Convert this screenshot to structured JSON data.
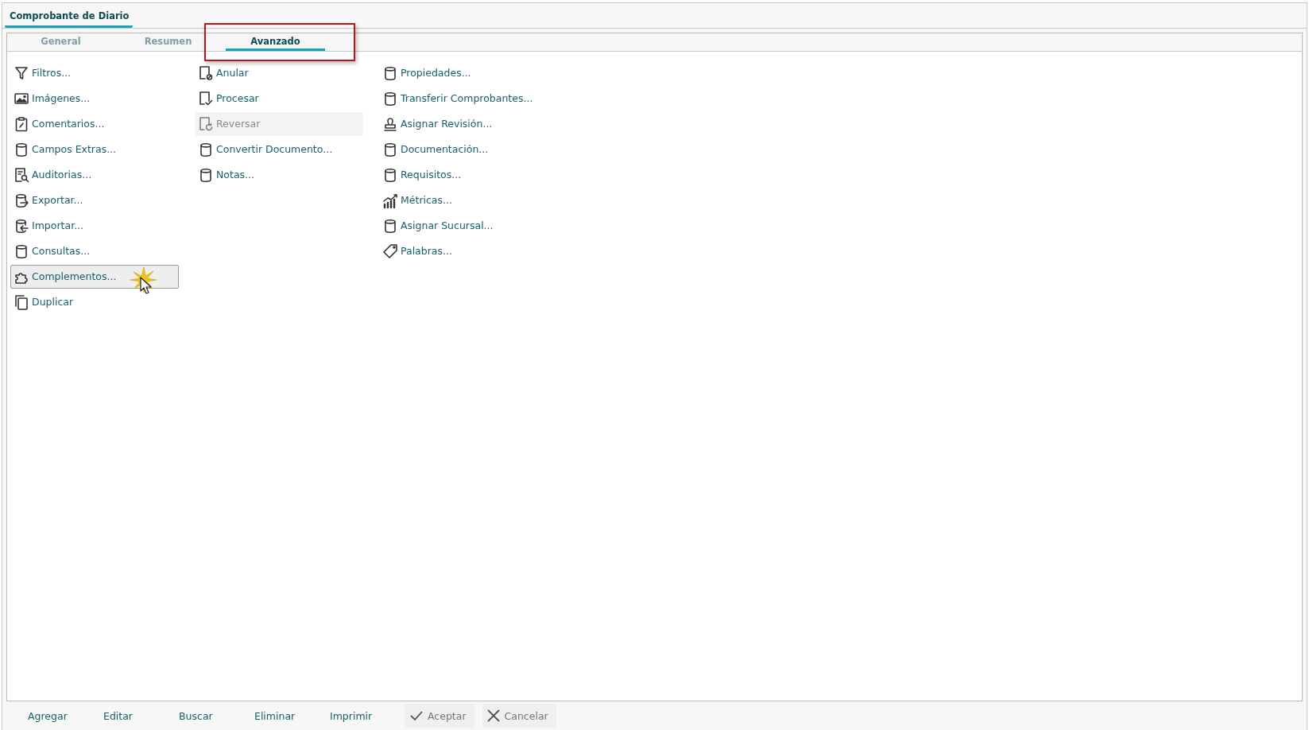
{
  "window": {
    "title": "Comprobante de Diario"
  },
  "tabs": [
    {
      "label": "General",
      "selected": false,
      "highlighted": false
    },
    {
      "label": "Resumen",
      "selected": false,
      "highlighted": false
    },
    {
      "label": "Avanzado",
      "selected": true,
      "highlighted": true
    }
  ],
  "columns": [
    [
      {
        "kind": "filter",
        "label": "Filtros...",
        "disabled": false,
        "hovered": false
      },
      {
        "kind": "image",
        "label": "Imágenes...",
        "disabled": false,
        "hovered": false
      },
      {
        "kind": "clipboard",
        "label": "Comentarios...",
        "disabled": false,
        "hovered": false
      },
      {
        "kind": "database",
        "label": "Campos Extras...",
        "disabled": false,
        "hovered": false
      },
      {
        "kind": "audit",
        "label": "Auditorias...",
        "disabled": false,
        "hovered": false
      },
      {
        "kind": "export",
        "label": "Exportar...",
        "disabled": false,
        "hovered": false
      },
      {
        "kind": "import",
        "label": "Importar...",
        "disabled": false,
        "hovered": false
      },
      {
        "kind": "database",
        "label": "Consultas...",
        "disabled": false,
        "hovered": false
      },
      {
        "kind": "puzzle",
        "label": "Complementos...",
        "disabled": false,
        "hovered": true
      },
      {
        "kind": "copy",
        "label": "Duplicar",
        "disabled": false,
        "hovered": false
      }
    ],
    [
      {
        "kind": "doc-cancel",
        "label": "Anular",
        "disabled": false,
        "hovered": false
      },
      {
        "kind": "doc-check",
        "label": "Procesar",
        "disabled": false,
        "hovered": false
      },
      {
        "kind": "doc-refresh",
        "label": "Reversar",
        "disabled": true,
        "hovered": false
      },
      {
        "kind": "database",
        "label": "Convertir Documento...",
        "disabled": false,
        "hovered": false
      },
      {
        "kind": "database",
        "label": "Notas...",
        "disabled": false,
        "hovered": false
      }
    ],
    [
      {
        "kind": "database",
        "label": "Propiedades...",
        "disabled": false,
        "hovered": false
      },
      {
        "kind": "database",
        "label": "Transferir Comprobantes...",
        "disabled": false,
        "hovered": false
      },
      {
        "kind": "stamp",
        "label": "Asignar Revisión...",
        "disabled": false,
        "hovered": false
      },
      {
        "kind": "database",
        "label": "Documentación...",
        "disabled": false,
        "hovered": false
      },
      {
        "kind": "database",
        "label": "Requisitos...",
        "disabled": false,
        "hovered": false
      },
      {
        "kind": "chart",
        "label": "Métricas...",
        "disabled": false,
        "hovered": false
      },
      {
        "kind": "database",
        "label": "Asignar Sucursal...",
        "disabled": false,
        "hovered": false
      },
      {
        "kind": "tag",
        "label": "Palabras...",
        "disabled": false,
        "hovered": false
      }
    ]
  ],
  "footer_buttons": [
    {
      "kind": "link",
      "label": "Agregar"
    },
    {
      "kind": "link",
      "label": "Editar"
    },
    {
      "kind": "link",
      "label": "Buscar"
    },
    {
      "kind": "link",
      "label": "Eliminar"
    },
    {
      "kind": "link",
      "label": "Imprimir"
    },
    {
      "kind": "accept",
      "label": "Aceptar"
    },
    {
      "kind": "cancel",
      "label": "Cancelar"
    }
  ]
}
